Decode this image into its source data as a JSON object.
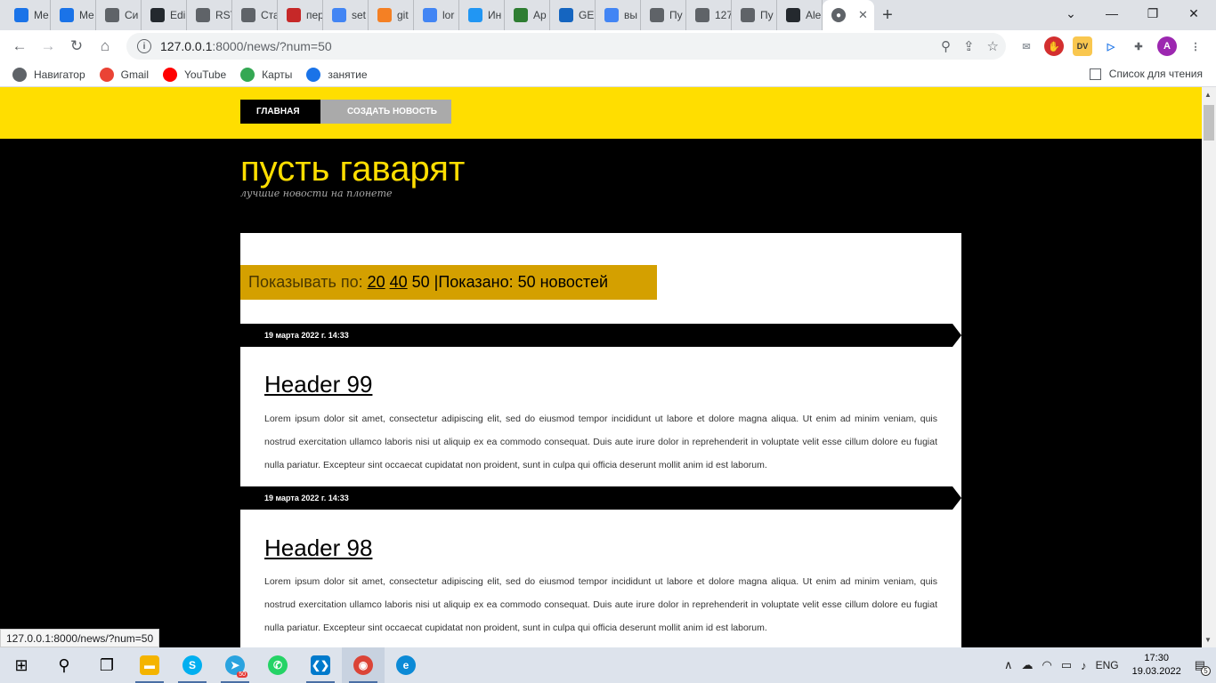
{
  "browser": {
    "tabs": [
      {
        "label": "Me",
        "icon": "chat-icon",
        "color": "#1a73e8"
      },
      {
        "label": "Me",
        "icon": "chat-icon",
        "color": "#1a73e8"
      },
      {
        "label": "Си",
        "icon": "gear-icon",
        "color": "#5f6368"
      },
      {
        "label": "Edi",
        "icon": "github-icon",
        "color": "#24292e"
      },
      {
        "label": "RST",
        "icon": "grid-icon",
        "color": "#5f6368"
      },
      {
        "label": "Ста",
        "icon": "grid-icon",
        "color": "#5f6368"
      },
      {
        "label": "пер",
        "icon": "translate-icon",
        "color": "#c62828"
      },
      {
        "label": "set",
        "icon": "google-icon",
        "color": "#4285f4"
      },
      {
        "label": "git",
        "icon": "stackoverflow-icon",
        "color": "#f48024"
      },
      {
        "label": "lor",
        "icon": "google-icon",
        "color": "#4285f4"
      },
      {
        "label": "Ин",
        "icon": "cloud-icon",
        "color": "#2196f3"
      },
      {
        "label": "Ap",
        "icon": "app-icon",
        "color": "#2e7d32"
      },
      {
        "label": "GE",
        "icon": "postman-icon",
        "color": "#1565c0"
      },
      {
        "label": "вы",
        "icon": "google-icon",
        "color": "#4285f4"
      },
      {
        "label": "Пу",
        "icon": "globe-icon",
        "color": "#5f6368"
      },
      {
        "label": "127",
        "icon": "globe-icon",
        "color": "#5f6368"
      },
      {
        "label": "Пу",
        "icon": "globe-icon",
        "color": "#5f6368"
      },
      {
        "label": "Ale",
        "icon": "github-icon",
        "color": "#24292e"
      }
    ],
    "active_tab_icon": "globe-icon",
    "url_host": "127.0.0.1",
    "url_path": ":8000/news/?num=50",
    "bookmarks": [
      {
        "label": "Навигатор",
        "icon": "globe-icon",
        "color": "#5f6368"
      },
      {
        "label": "Gmail",
        "icon": "gmail-icon",
        "color": "#ea4335"
      },
      {
        "label": "YouTube",
        "icon": "youtube-icon",
        "color": "#ff0000"
      },
      {
        "label": "Карты",
        "icon": "maps-icon",
        "color": "#34a853"
      },
      {
        "label": "занятие",
        "icon": "clock-icon",
        "color": "#1a73e8"
      }
    ],
    "reading_list": "Список для чтения",
    "profile_initial": "A",
    "status_url": "127.0.0.1:8000/news/?num=50"
  },
  "site": {
    "nav_home": "ГЛАВНАЯ",
    "nav_create": "СОЗДАТЬ НОВОСТЬ",
    "title": "пусть гаварят",
    "subtitle": "лучшие новости на плонете",
    "pager": {
      "label": "Показывать по:",
      "option_20": "20",
      "option_40": "40",
      "current": "50",
      "shown": "|Показано: 50 новостей"
    },
    "news": [
      {
        "date": "19 марта 2022 г. 14:33",
        "title": "Header 99",
        "body": "Lorem ipsum dolor sit amet, consectetur adipiscing elit, sed do eiusmod tempor incididunt ut labore et dolore magna aliqua. Ut enim ad minim veniam, quis nostrud exercitation ullamco laboris nisi ut aliquip ex ea commodo consequat. Duis aute irure dolor in reprehenderit in voluptate velit esse cillum dolore eu fugiat nulla pariatur. Excepteur sint occaecat cupidatat non proident, sunt in culpa qui officia deserunt mollit anim id est laborum."
      },
      {
        "date": "19 марта 2022 г. 14:33",
        "title": "Header 98",
        "body": "Lorem ipsum dolor sit amet, consectetur adipiscing elit, sed do eiusmod tempor incididunt ut labore et dolore magna aliqua. Ut enim ad minim veniam, quis nostrud exercitation ullamco laboris nisi ut aliquip ex ea commodo consequat. Duis aute irure dolor in reprehenderit in voluptate velit esse cillum dolore eu fugiat nulla pariatur. Excepteur sint occaecat cupidatat non proident, sunt in culpa qui officia deserunt mollit anim id est laborum."
      }
    ],
    "colors": {
      "accent": "#ffde00",
      "pager": "#d4a000"
    }
  },
  "taskbar": {
    "telegram_badge": "50",
    "lang": "ENG",
    "time": "17:30",
    "date": "19.03.2022",
    "notifications": "5"
  }
}
